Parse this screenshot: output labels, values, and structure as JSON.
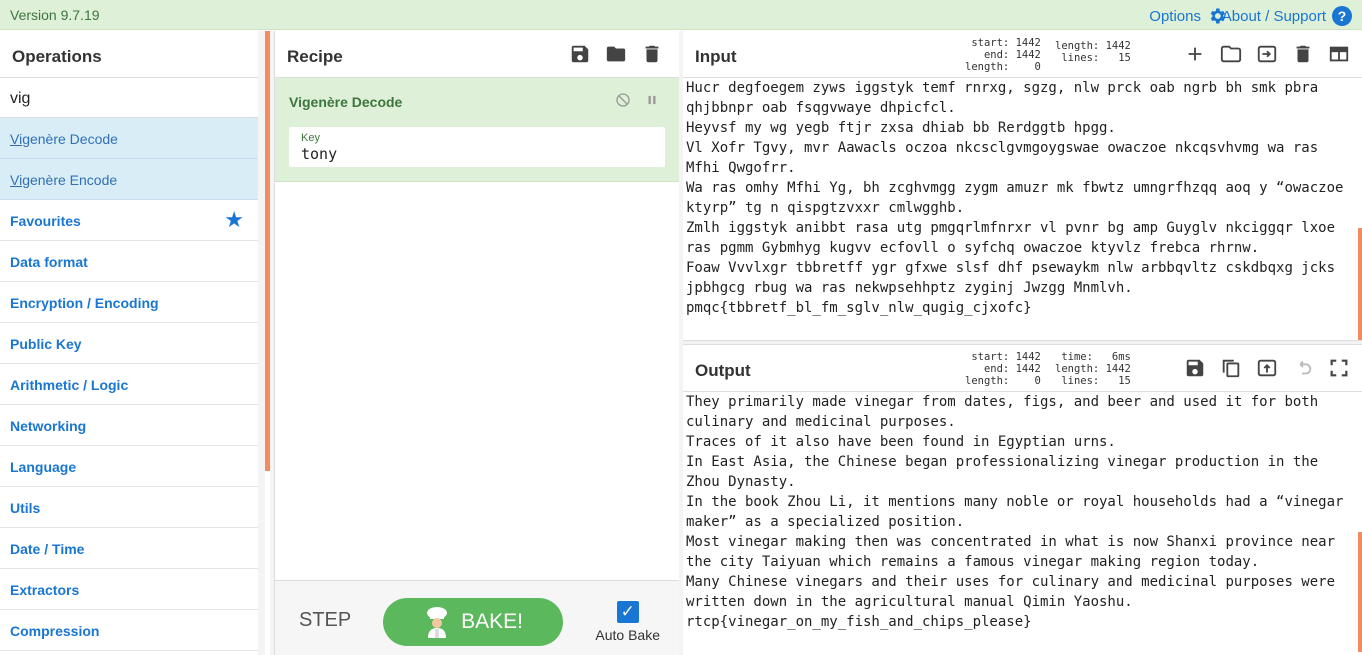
{
  "banner": {
    "version": "Version 9.7.19",
    "options": "Options",
    "about": "About / Support"
  },
  "operations": {
    "title": "Operations",
    "search_value": "vig",
    "results": [
      {
        "match": "Vig",
        "rest": "enère Decode"
      },
      {
        "match": "Vig",
        "rest": "enère Encode"
      }
    ],
    "categories": [
      "Favourites",
      "Data format",
      "Encryption / Encoding",
      "Public Key",
      "Arithmetic / Logic",
      "Networking",
      "Language",
      "Utils",
      "Date / Time",
      "Extractors",
      "Compression"
    ]
  },
  "recipe": {
    "title": "Recipe",
    "operation": {
      "name": "Vigenère Decode",
      "key_label": "Key",
      "key_value": "tony"
    },
    "step_label": "STEP",
    "bake_label": "BAKE!",
    "auto_bake_label": "Auto Bake",
    "auto_bake_checked": true
  },
  "input": {
    "title": "Input",
    "stats_left": "start: 1442\n  end: 1442\nlength:    0",
    "stats_right": "length: 1442\n lines:   15",
    "text": "Hucr degfoegem zyws iggstyk temf rnrxg, sgzg, nlw prck oab ngrb bh smk pbra\nqhjbbnpr oab fsqgvwaye dhpicfcl.\nHeyvsf my wg yegb ftjr zxsa dhiab bb Rerdggtb hpgg.\nVl Xofr Tgvy, mvr Aawacls oczoa nkcsclgvmgoygswae owaczoe nkcqsvhvmg wa ras\nMfhi Qwgofrr.\nWa ras omhy Mfhi Yg, bh zcghvmgg zygm amuzr mk fbwtz umngrfhzqq aoq y “owaczoe\nktyrp” tg n qispgtzvxxr cmlwgghb.\nZmlh iggstyk anibbt rasa utg pmgqrlmfnrxr vl pvnr bg amp Guyglv nkciggqr lxoe\nras pgmm Gybmhyg kugvv ecfovll o syfchq owaczoe ktyvlz frebca rhrnw.\nFoaw Vvvlxgr tbbretff ygr gfxwe slsf dhf psewaykm nlw arbbqvltz cskdbqxg jcks\njpbhgcg rbug wa ras nekwpsehhptz zyginj Jwzgg Mnmlvh.\npmqc{tbbretf_bl_fm_sglv_nlw_qugig_cjxofc}"
  },
  "output": {
    "title": "Output",
    "stats_left": "start: 1442\n  end: 1442\nlength:    0",
    "stats_right": "time:   6ms\nlength: 1442\n lines:   15",
    "text": "They primarily made vinegar from dates, figs, and beer and used it for both\nculinary and medicinal purposes.\nTraces of it also have been found in Egyptian urns.\nIn East Asia, the Chinese began professionalizing vinegar production in the\nZhou Dynasty.\nIn the book Zhou Li, it mentions many noble or royal households had a “vinegar\nmaker” as a specialized position.\nMost vinegar making then was concentrated in what is now Shanxi province near\nthe city Taiyuan which remains a famous vinegar making region today.\nMany Chinese vinegars and their uses for culinary and medicinal purposes were\nwritten down in the agricultural manual Qimin Yaoshu.\nrtcp{vinegar_on_my_fish_and_chips_please}"
  },
  "colors": {
    "accent": "#1976d2",
    "banner_bg": "#dff0d8",
    "search_hit_bg": "#d9edf7",
    "bake_green": "#5cb85c",
    "divider_orange": "#f58a5e"
  },
  "icons": [
    "gear-icon",
    "help-icon",
    "star-icon",
    "save-icon",
    "folder-icon",
    "trash-icon",
    "disable-icon",
    "pause-icon",
    "chef-icon",
    "plus-icon",
    "file-in-icon",
    "layout-icon",
    "copy-icon",
    "replace-input-icon",
    "undo-icon",
    "maximize-icon"
  ]
}
